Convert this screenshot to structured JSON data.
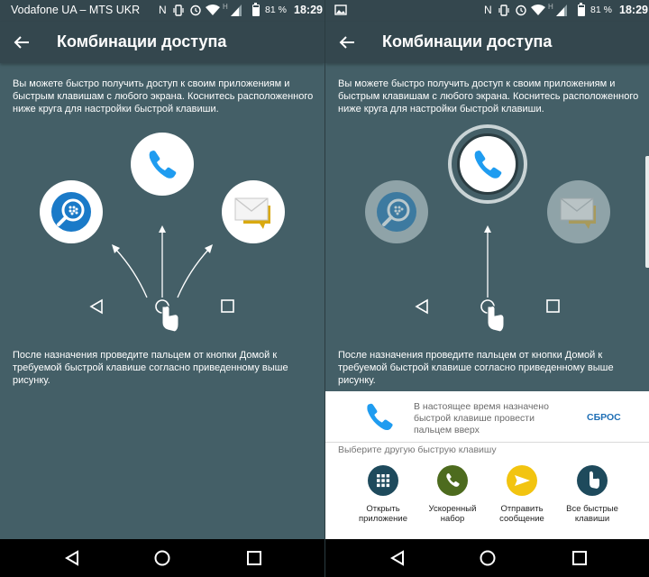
{
  "status_left": {
    "carrier": "Vodafone UA – MTS UKR",
    "battery_percent": "81 %",
    "time": "18:29",
    "battery_level": 0.81
  },
  "status_right": {
    "battery_percent": "81 %",
    "time": "18:29",
    "battery_level": 0.81
  },
  "app_bar": {
    "title": "Комбинации доступа"
  },
  "intro_text": "Вы можете быстро получить доступ к своим приложениям и быстрым клавишам с любого экрана. Коснитесь расположенного ниже круга для настройки быстрой клавиши.",
  "hint_text": "После назначения проведите пальцем от кнопки Домой к требуемой быстрой клавише согласно приведенному выше рисунку.",
  "shortcuts": [
    {
      "name": "blackberry-search",
      "icon": "bb-search-icon"
    },
    {
      "name": "phone",
      "icon": "phone-icon"
    },
    {
      "name": "messages",
      "icon": "envelope-icon"
    }
  ],
  "sheet": {
    "current_text": "В настоящее время назначено быстрой клавише провести пальцем вверх",
    "reset_label": "СБРОС",
    "choose_label": "Выберите другую быструю клавишу",
    "options": [
      {
        "label": "Открыть\nприложение",
        "icon": "app-grid-icon",
        "color": "#1e4a5c"
      },
      {
        "label": "Ускоренный\nнабор",
        "icon": "speed-dial-icon",
        "color": "#4d6b1e"
      },
      {
        "label": "Отправить\nсообщение",
        "icon": "send-message-icon",
        "color": "#f2c410"
      },
      {
        "label": "Все быстрые\nклавиши",
        "icon": "all-shortcuts-icon",
        "color": "#1e4a5c"
      }
    ]
  },
  "colors": {
    "background": "#445f67",
    "app_bar": "#34474e",
    "phone_blue": "#1f9cf0",
    "accent_blue": "#1f6fb5"
  }
}
